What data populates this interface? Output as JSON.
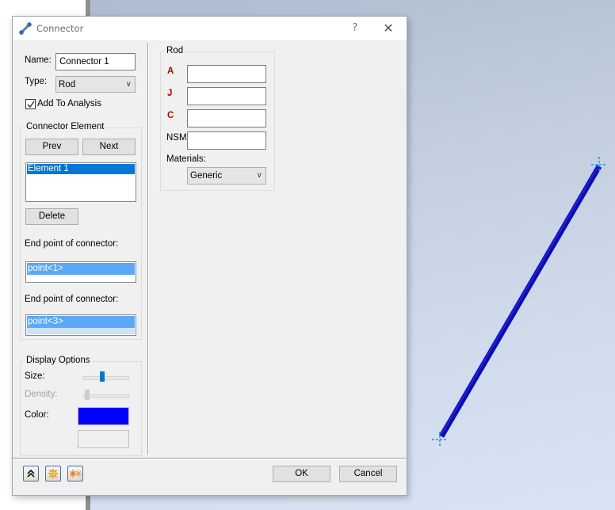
{
  "dialog": {
    "title": "Connector",
    "help_label": "?",
    "close_label": "✕"
  },
  "general": {
    "name_label": "Name:",
    "name_value": "Connector 1",
    "type_label": "Type:",
    "type_value": "Rod",
    "add_to_analysis_label": "Add To Analysis",
    "add_to_analysis_checked": true
  },
  "connector_element": {
    "group_title": "Connector Element",
    "prev_label": "Prev",
    "next_label": "Next",
    "elements": [
      "Element 1"
    ],
    "selected_element": "Element 1",
    "delete_label": "Delete",
    "end_point_1_label": "End point of connector:",
    "end_point_1_value": "point<1>",
    "end_point_2_label": "End point of connector:",
    "end_point_2_value": "point<3>"
  },
  "display_options": {
    "group_title": "Display Options",
    "size_label": "Size:",
    "size_value_fraction": 0.42,
    "density_label": "Density:",
    "density_value_fraction": 0.05,
    "density_enabled": false,
    "color_label": "Color:",
    "color_value": "#0000ff"
  },
  "rod": {
    "group_title": "Rod",
    "a_label": "A",
    "a_value": "",
    "j_label": "J",
    "j_value": "",
    "c_label": "C",
    "c_value": "",
    "nsm_label": "NSM:",
    "nsm_value": "",
    "materials_label": "Materials:",
    "materials_value": "Generic"
  },
  "footer": {
    "icon_buttons": [
      "collapse-icon",
      "explode-icon",
      "explode-all-icon"
    ],
    "ok_label": "OK",
    "cancel_label": "Cancel"
  },
  "viewport": {
    "connector_color": "#0000c8",
    "endpoint_marker_color": "#1e90ff"
  }
}
